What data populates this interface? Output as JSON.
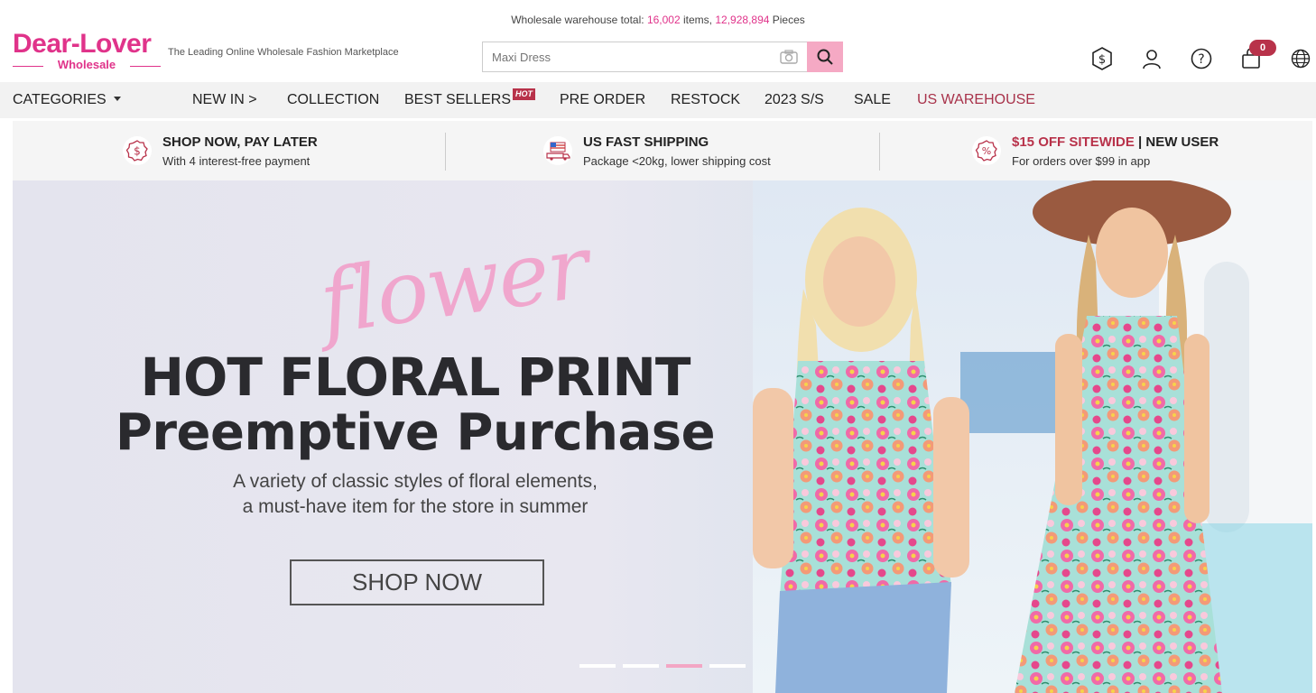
{
  "topbar": {
    "prefix": "Wholesale warehouse total:",
    "items_count": "16,002",
    "items_label": "items,",
    "pieces_count": "12,928,894",
    "pieces_label": "Pieces"
  },
  "logo": {
    "brand": "Dear-Lover",
    "sub": "Wholesale"
  },
  "tagline": "The Leading Online Wholesale Fashion Marketplace",
  "search": {
    "placeholder": "Maxi Dress"
  },
  "header_icons": {
    "cart_count": "0"
  },
  "nav": {
    "categories": "CATEGORIES",
    "new_in": "NEW IN >",
    "collection": "COLLECTION",
    "best_sellers": "BEST SELLERS",
    "hot_badge": "HOT",
    "pre_order": "PRE ORDER",
    "restock": "RESTOCK",
    "ss2023": "2023 S/S",
    "sale": "SALE",
    "us_warehouse": "US WAREHOUSE"
  },
  "benefits": [
    {
      "title": "SHOP NOW, PAY LATER",
      "sub": "With 4 interest-free payment"
    },
    {
      "title": "US FAST SHIPPING",
      "sub": "Package <20kg, lower shipping cost"
    },
    {
      "title_accent": "$15 OFF SITEWIDE",
      "title_rest": " | NEW USER",
      "sub": "For orders over $99 in app"
    }
  ],
  "hero": {
    "script_word": "flower",
    "headline": "HOT FLORAL PRINT",
    "subheadline": "Preemptive Purchase",
    "desc_line1": "A variety of classic styles of floral elements,",
    "desc_line2": "a must-have item for the store in summer",
    "cta": "SHOP NOW",
    "active_slide": 3,
    "slide_count": 4
  },
  "colors": {
    "brand": "#e0338a",
    "accent": "#b8324a",
    "search_button": "#f5a9c4"
  }
}
